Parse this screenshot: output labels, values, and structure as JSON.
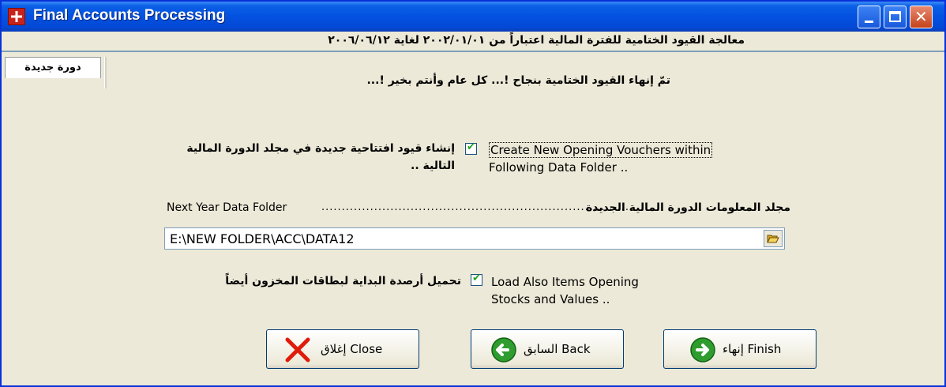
{
  "window": {
    "title": "Final Accounts Processing"
  },
  "icons": {
    "app": "app-icon",
    "folder": "folder-open-icon",
    "close": "close-x-icon",
    "back": "back-arrow-icon",
    "finish": "finish-arrow-icon"
  },
  "colors": {
    "title_bar": "#0451e0",
    "face": "#ece9d8",
    "check": "#21a121",
    "close_x": "#e01b0c",
    "arrow_green": "#2e9c2e"
  },
  "header": {
    "period_text": "معالجة القيود الختامية للفترة المالية  اعتباراً من ٢٠٠٢/٠١/٠١ لغاية ٢٠٠٦/٠٦/١٢"
  },
  "tabs": {
    "new_cycle": "دورة جديدة"
  },
  "message": {
    "success": "تمّ إنهاء القيود الختامية بنجاح  !...    كل عام وأنتم بخير !..."
  },
  "options": {
    "create_vouchers": {
      "checked": true,
      "label_ar": "إنشاء قيود افتتاحية جديدة في مجلد الدورة المالية التالية ..",
      "label_en_1": "Create New Opening Vouchers within",
      "label_en_2": "Following Data Folder .."
    },
    "load_items": {
      "checked": true,
      "label_ar": "تحميل أرصدة البداية لبطاقات المخزون أيضاً",
      "label_en_1": "Load Also Items Opening",
      "label_en_2": "Stocks and Values .."
    }
  },
  "folder": {
    "label_en": "Next Year Data Folder",
    "dots": "............................................................................",
    "label_ar": "مجلد المعلومات الدورة المالية الجديدة",
    "path": "E:\\NEW FOLDER\\ACC\\DATA12"
  },
  "buttons": {
    "close": "إغلاق  Close",
    "back": "السابق  Back",
    "finish": "إنهاء  Finish"
  }
}
